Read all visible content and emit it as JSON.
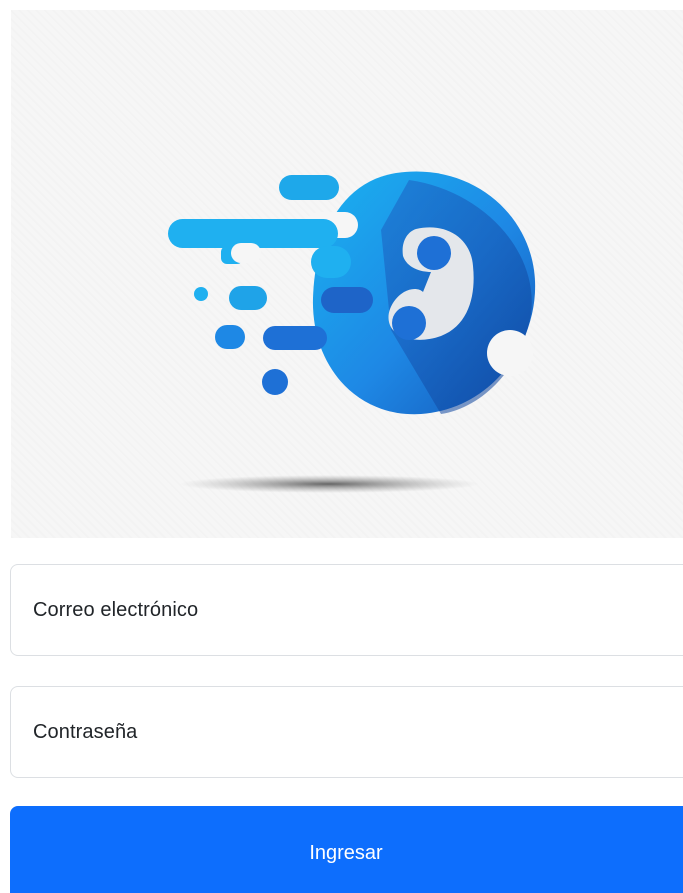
{
  "logo": {
    "icon": "chat-support-logo",
    "colors": {
      "primary": "#1565c0",
      "secondary": "#1e88e5",
      "light": "#29b6f6",
      "accent": "#e8eaed"
    }
  },
  "form": {
    "email_label": "Correo electrónico",
    "password_label": "Contraseña",
    "submit_label": "Ingresar"
  },
  "theme": {
    "button_color": "#0d6efd",
    "field_border": "#dcdfe3"
  }
}
